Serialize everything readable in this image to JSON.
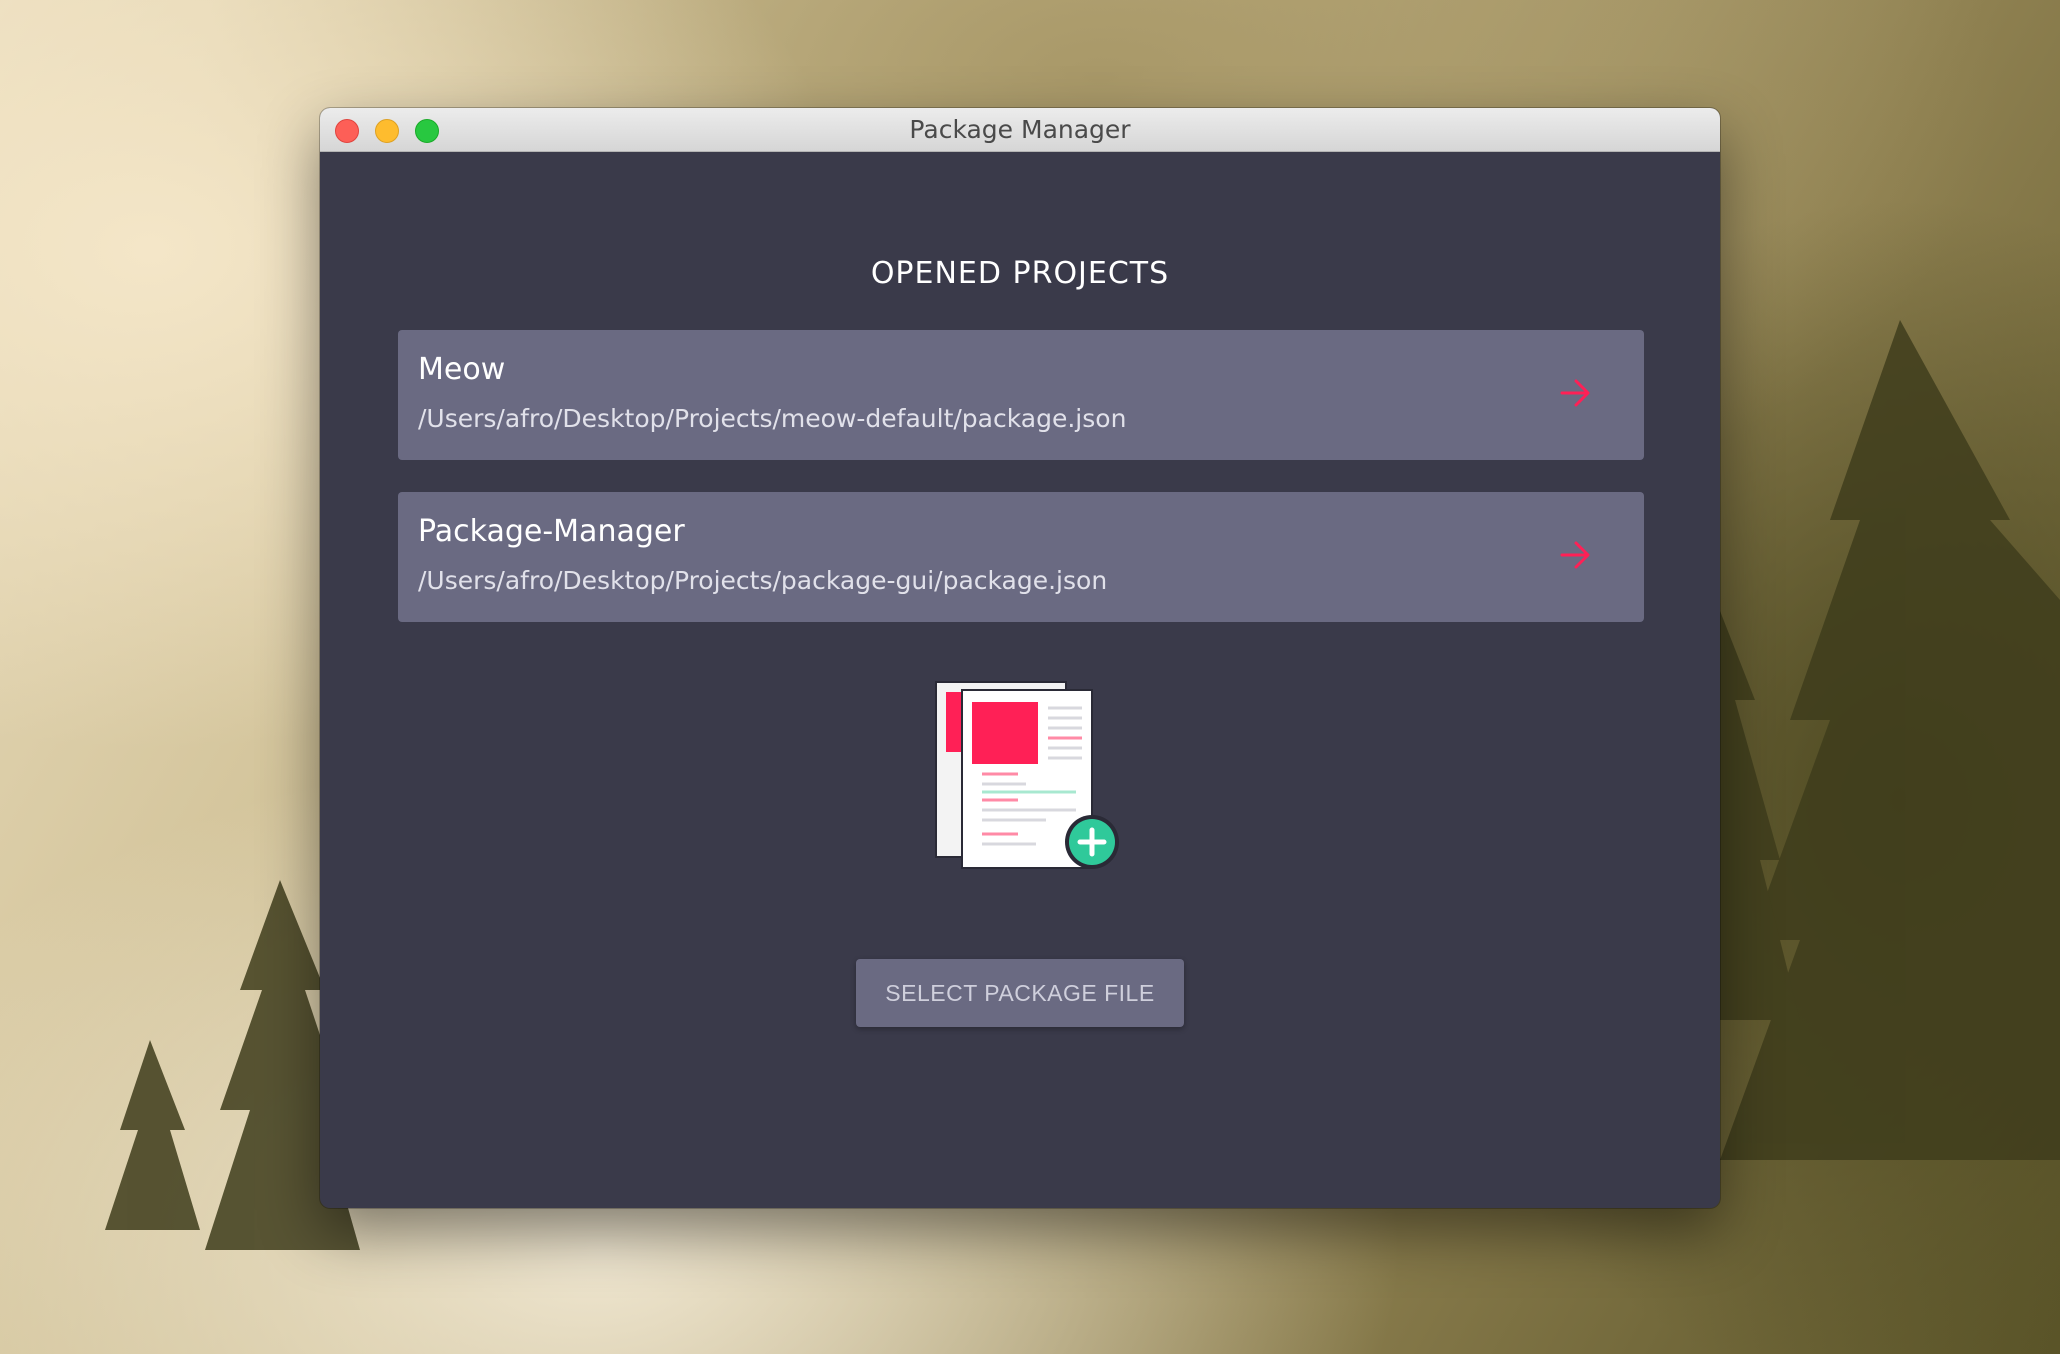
{
  "window": {
    "title": "Package Manager"
  },
  "main": {
    "heading": "OPENED PROJECTS",
    "projects": [
      {
        "name": "Meow",
        "path": "/Users/afro/Desktop/Projects/meow-default/package.json"
      },
      {
        "name": "Package-Manager",
        "path": "/Users/afro/Desktop/Projects/package-gui/package.json"
      }
    ],
    "select_button_label": "SELECT PACKAGE FILE"
  },
  "colors": {
    "window_bg": "#3a3a4a",
    "card_bg": "#6a6a82",
    "accent_pink": "#ff2056",
    "accent_green": "#2fc99a"
  },
  "icons": {
    "project_open": "arrow-right-icon",
    "illustration": "package-files-add-icon"
  }
}
